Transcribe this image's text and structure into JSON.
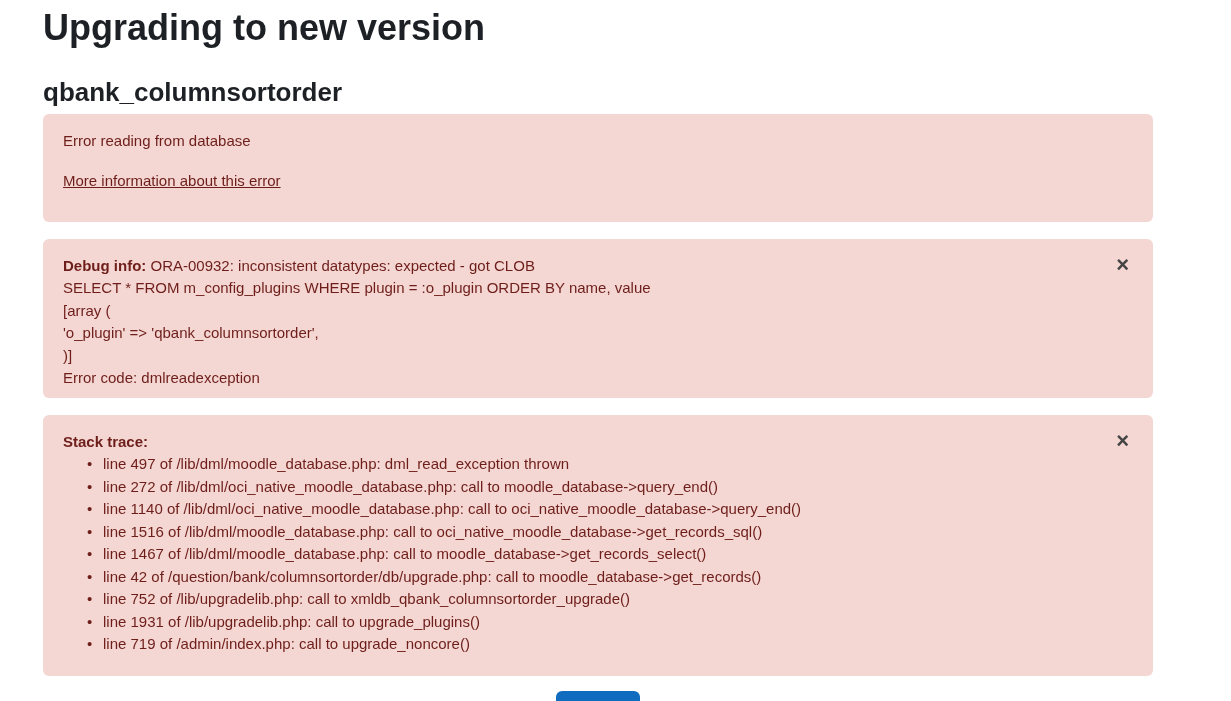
{
  "title": "Upgrading to new version",
  "subtitle": "qbank_columnsortorder",
  "error": {
    "message": "Error reading from database",
    "link": "More information about this error"
  },
  "debug": {
    "label": "Debug info:",
    "first_line": "ORA-00932: inconsistent datatypes: expected - got CLOB",
    "lines": [
      "SELECT * FROM m_config_plugins WHERE plugin = :o_plugin ORDER BY name, value",
      "[array (",
      "'o_plugin' => 'qbank_columnsortorder',",
      ")]",
      "Error code: dmlreadexception"
    ],
    "close": "×"
  },
  "stack": {
    "label": "Stack trace:",
    "close": "×",
    "bullet": "•",
    "items": [
      "line 497 of /lib/dml/moodle_database.php: dml_read_exception thrown",
      "line 272 of /lib/dml/oci_native_moodle_database.php: call to moodle_database->query_end()",
      "line 1140 of /lib/dml/oci_native_moodle_database.php: call to oci_native_moodle_database->query_end()",
      "line 1516 of /lib/dml/moodle_database.php: call to oci_native_moodle_database->get_records_sql()",
      "line 1467 of /lib/dml/moodle_database.php: call to moodle_database->get_records_select()",
      "line 42 of /question/bank/columnsortorder/db/upgrade.php: call to moodle_database->get_records()",
      "line 752 of /lib/upgradelib.php: call to xmldb_qbank_columnsortorder_upgrade()",
      "line 1931 of /lib/upgradelib.php: call to upgrade_plugins()",
      "line 719 of /admin/index.php: call to upgrade_noncore()"
    ]
  }
}
